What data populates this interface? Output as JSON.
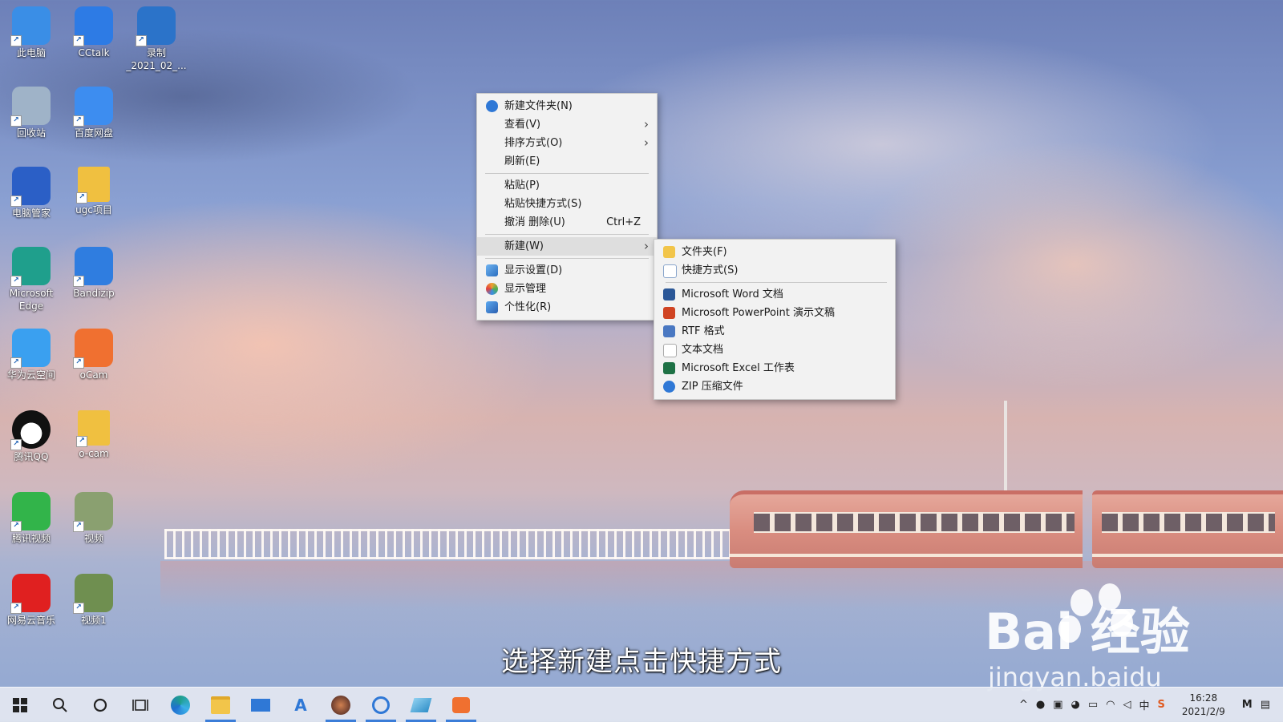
{
  "desktop_icons": [
    {
      "label": "此电脑",
      "icon": "computer-icon",
      "color": "#3a8ee6"
    },
    {
      "label": "CCtalk",
      "icon": "cctalk-icon",
      "color": "#2d7be5"
    },
    {
      "label": "录制\n_2021_02_...",
      "icon": "video-file-icon",
      "color": "#2b73c9"
    },
    {
      "label": "回收站",
      "icon": "recycle-bin-icon",
      "color": "#9fb3c8"
    },
    {
      "label": "百度网盘",
      "icon": "baidu-netdisk-icon",
      "color": "#3d8df0"
    },
    {
      "label": "电脑管家",
      "icon": "pc-manager-icon",
      "color": "#2b5fc6"
    },
    {
      "label": "ugc项目",
      "icon": "folder-icon",
      "color": "#f0c040"
    },
    {
      "label": "Microsoft\nEdge",
      "icon": "edge-icon",
      "color": "#1f9f8c"
    },
    {
      "label": "Bandizip",
      "icon": "bandizip-icon",
      "color": "#2f7de0"
    },
    {
      "label": "华为云空间",
      "icon": "huawei-cloud-icon",
      "color": "#3aa0f0"
    },
    {
      "label": "oCam",
      "icon": "ocam-icon",
      "color": "#f07030"
    },
    {
      "label": "腾讯QQ",
      "icon": "qq-icon",
      "color": "#111111"
    },
    {
      "label": "o-cam",
      "icon": "folder-icon",
      "color": "#f0c040"
    },
    {
      "label": "腾讯视频",
      "icon": "tencent-video-icon",
      "color": "#32b44a"
    },
    {
      "label": "视频",
      "icon": "video-thumb-icon",
      "color": "#8aa070"
    },
    {
      "label": "网易云音乐",
      "icon": "netease-music-icon",
      "color": "#e02020"
    },
    {
      "label": "视频1",
      "icon": "video-thumb-icon",
      "color": "#6f8f50"
    }
  ],
  "context_menu": {
    "items": [
      {
        "label": "新建文件夹(N)",
        "icon": "new-folder-icon"
      },
      {
        "label": "查看(V)",
        "submenu": true
      },
      {
        "label": "排序方式(O)",
        "submenu": true
      },
      {
        "label": "刷新(E)"
      },
      {
        "label": "粘贴(P)"
      },
      {
        "label": "粘贴快捷方式(S)"
      },
      {
        "label": "撤消 删除(U)",
        "shortcut": "Ctrl+Z"
      },
      {
        "label": "新建(W)",
        "submenu": true,
        "highlighted": true
      },
      {
        "label": "显示设置(D)",
        "icon": "display-settings-icon"
      },
      {
        "label": "显示管理",
        "icon": "display-manager-icon"
      },
      {
        "label": "个性化(R)",
        "icon": "personalize-icon"
      }
    ]
  },
  "new_submenu": {
    "items": [
      {
        "label": "文件夹(F)",
        "icon": "folder-icon"
      },
      {
        "label": "快捷方式(S)",
        "icon": "shortcut-icon"
      },
      {
        "label": "Microsoft Word 文档",
        "icon": "word-icon"
      },
      {
        "label": "Microsoft PowerPoint 演示文稿",
        "icon": "powerpoint-icon"
      },
      {
        "label": "RTF 格式",
        "icon": "rtf-icon"
      },
      {
        "label": "文本文档",
        "icon": "text-file-icon"
      },
      {
        "label": "Microsoft Excel 工作表",
        "icon": "excel-icon"
      },
      {
        "label": "ZIP 压缩文件",
        "icon": "zip-icon"
      }
    ]
  },
  "subtitle": "选择新建点击快捷方式",
  "watermark": {
    "brand": "Bai  经验",
    "url": "jingyan.baidu"
  },
  "taskbar": {
    "apps": [
      "start-icon",
      "search-icon",
      "cortana-icon",
      "task-view-icon",
      "edge-icon",
      "file-explorer-icon",
      "mail-icon",
      "text-app-icon",
      "photo-app-icon",
      "cctalk-icon",
      "notes-app-icon",
      "ocam-icon"
    ],
    "tray_ime": "中",
    "time": "16:28",
    "date": "2021/2/9"
  }
}
